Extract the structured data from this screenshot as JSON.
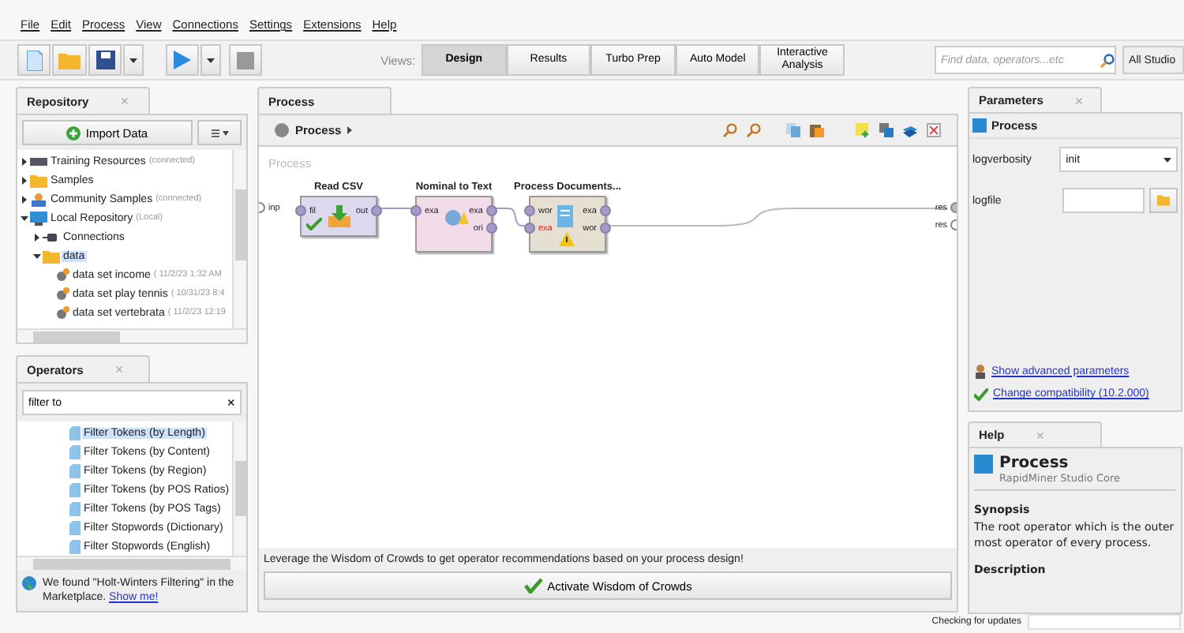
{
  "menu": [
    "File",
    "Edit",
    "Process",
    "View",
    "Connections",
    "Settings",
    "Extensions",
    "Help"
  ],
  "toolbar": {
    "views_label": "Views:",
    "views": [
      {
        "label": "Design",
        "selected": true
      },
      {
        "label": "Results",
        "selected": false
      },
      {
        "label": "Turbo Prep",
        "selected": false
      },
      {
        "label": "Auto Model",
        "selected": false
      },
      {
        "label": "Interactive Analysis",
        "selected": false
      }
    ],
    "search": {
      "placeholder": "Find data, operators...etc"
    },
    "scope": "All Studio"
  },
  "repository": {
    "tab": "Repository",
    "tab_close": "×",
    "import_button": "Import Data",
    "tree": [
      {
        "label": "Training Resources",
        "note": "(connected)",
        "kind": "server",
        "expanded": false,
        "selected": false
      },
      {
        "label": "Samples",
        "kind": "folder",
        "expanded": false,
        "selected": false
      },
      {
        "label": "Community Samples",
        "note": "(connected)",
        "kind": "people",
        "expanded": false,
        "selected": false
      },
      {
        "label": "Local Repository",
        "note": "(Local)",
        "kind": "repo",
        "expanded": true,
        "selected": false,
        "children": [
          {
            "label": "Connections",
            "kind": "plug",
            "expanded": false,
            "selected": false
          },
          {
            "label": "data",
            "kind": "folder",
            "expanded": true,
            "selected": true,
            "children": [
              {
                "label": "data set income",
                "note": "( 11/2/23 1:32 AM",
                "kind": "dataset",
                "selected": false
              },
              {
                "label": "data set play tennis",
                "note": "( 10/31/23 8:4",
                "kind": "dataset",
                "selected": false
              },
              {
                "label": "data set vertebrata",
                "note": "( 11/2/23 12:19",
                "kind": "dataset",
                "selected": false
              }
            ]
          }
        ]
      }
    ]
  },
  "operators": {
    "tab": "Operators",
    "tab_close": "×",
    "search": {
      "value": "filter to",
      "clear": "×"
    },
    "items": [
      {
        "label": "Filter Tokens (by Length)",
        "selected": true
      },
      {
        "label": "Filter Tokens (by Content)",
        "selected": false
      },
      {
        "label": "Filter Tokens (by Region)",
        "selected": false
      },
      {
        "label": "Filter Tokens (by POS Ratios)",
        "selected": false
      },
      {
        "label": "Filter Tokens (by POS Tags)",
        "selected": false
      },
      {
        "label": "Filter Stopwords (Dictionary)",
        "selected": false
      },
      {
        "label": "Filter Stopwords (English)",
        "selected": false
      }
    ],
    "notice": {
      "text": "We found \"Holt-Winters Filtering\" in the Marketplace.",
      "link": "Show me!"
    }
  },
  "process": {
    "tab": "Process",
    "breadcrumb": "Process",
    "canvas_label": "Process",
    "input_ports": [
      "inp"
    ],
    "output_ports": [
      "res",
      "res"
    ],
    "operators": [
      {
        "name": "Read CSV",
        "color": "#dcd8ee",
        "valid": true,
        "warning": false,
        "inputs": [
          {
            "label": "fil",
            "error": false
          }
        ],
        "outputs": [
          {
            "label": "out",
            "error": false
          }
        ]
      },
      {
        "name": "Nominal to Text",
        "color": "#f2dcea",
        "valid": false,
        "warning": false,
        "inputs": [
          {
            "label": "exa",
            "error": false
          }
        ],
        "outputs": [
          {
            "label": "exa",
            "error": false
          },
          {
            "label": "ori",
            "error": false
          }
        ]
      },
      {
        "name": "Process Documents...",
        "color": "#e6e0d2",
        "valid": false,
        "warning": true,
        "inputs": [
          {
            "label": "wor",
            "error": false
          },
          {
            "label": "exa",
            "error": true
          }
        ],
        "outputs": [
          {
            "label": "exa",
            "error": false
          },
          {
            "label": "wor",
            "error": false
          }
        ]
      }
    ],
    "recommendation": "Leverage the Wisdom of Crowds to get operator recommendations based on your process design!",
    "activate_button": "Activate Wisdom of Crowds"
  },
  "parameters": {
    "tab": "Parameters",
    "tab_close": "×",
    "operator": "Process",
    "rows": [
      {
        "label": "logverbosity",
        "kind": "select",
        "value": "init"
      },
      {
        "label": "logfile",
        "kind": "file"
      }
    ],
    "links": [
      "Show advanced parameters",
      "Change compatibility (10.2.000)"
    ]
  },
  "help": {
    "tab": "Help",
    "tab_close": "×",
    "title": "Process",
    "subtitle": "RapidMiner Studio Core",
    "sections": [
      {
        "heading": "Synopsis",
        "text": "The root operator which is the outer most operator of every process."
      },
      {
        "heading": "Description"
      }
    ]
  },
  "status_bar": "Checking for updates"
}
